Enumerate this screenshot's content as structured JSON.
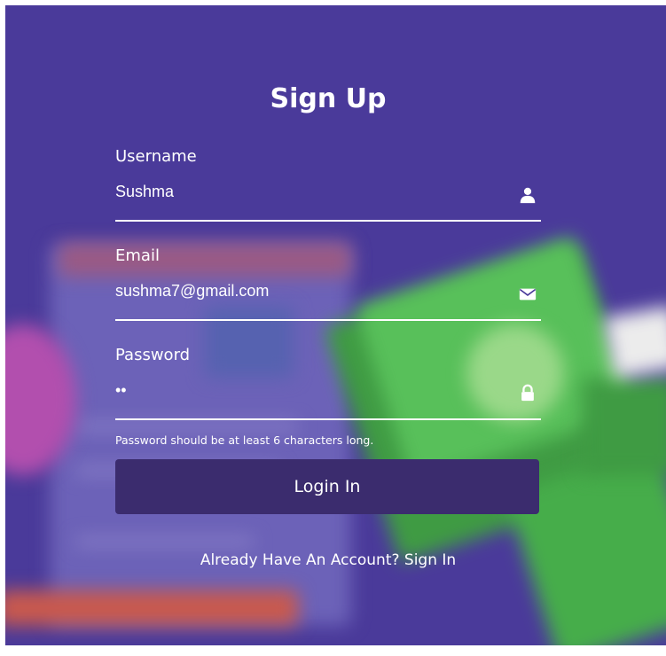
{
  "form": {
    "title": "Sign Up",
    "username": {
      "label": "Username",
      "value": "Sushma",
      "icon": "user-icon"
    },
    "email": {
      "label": "Email",
      "value": "sushma7@gmail.com",
      "icon": "envelope-icon"
    },
    "password": {
      "label": "Password",
      "value": "••",
      "icon": "lock-icon"
    },
    "hint": "Password should be at least 6 characters long.",
    "submit_label": "Login In",
    "signin_link": "Already Have An Account? Sign In"
  },
  "colors": {
    "background": "#4a3a9a",
    "button": "#3b2c6e",
    "text": "#ffffff"
  }
}
